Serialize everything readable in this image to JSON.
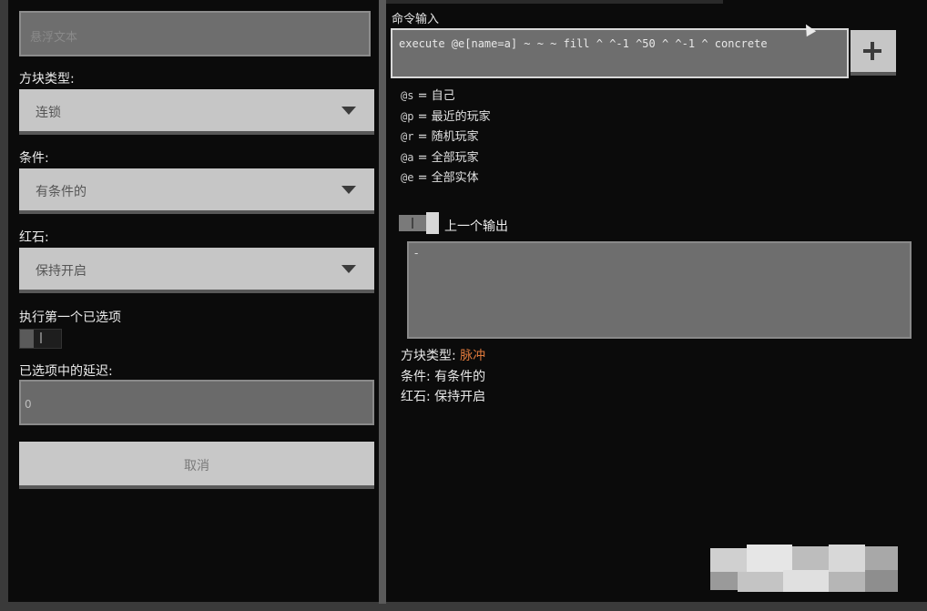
{
  "left_panel": {
    "hover_text_placeholder": "悬浮文本",
    "block_type_label": "方块类型:",
    "block_type_value": "连锁",
    "condition_label": "条件:",
    "condition_value": "有条件的",
    "redstone_label": "红石:",
    "redstone_value": "保持开启",
    "execute_first_label": "执行第一个已选项",
    "execute_first_enabled": false,
    "delay_label": "已选项中的延迟:",
    "delay_value": "0",
    "cancel_label": "取消"
  },
  "right_panel": {
    "command_input_label": "命令输入",
    "command_text": "execute @e[name=a] ~ ~ ~ fill ^ ^-1 ^50 ^ ^-1 ^ concrete",
    "add_button_icon": "plus-icon",
    "selectors": [
      {
        "code": "@s",
        "sep": " = ",
        "meaning": "自己"
      },
      {
        "code": "@p",
        "sep": " = ",
        "meaning": "最近的玩家"
      },
      {
        "code": "@r",
        "sep": " = ",
        "meaning": "随机玩家"
      },
      {
        "code": "@a",
        "sep": " = ",
        "meaning": "全部玩家"
      },
      {
        "code": "@e",
        "sep": " = ",
        "meaning": "全部实体"
      }
    ],
    "previous_output_label": "上一个输出",
    "previous_output_enabled": true,
    "previous_output_text": "-",
    "info": {
      "block_type_prefix": "方块类型: ",
      "block_type_value": "脉冲",
      "condition_line": "条件: 有条件的",
      "redstone_line": "红石: 保持开启"
    }
  },
  "colors": {
    "accent": "#e07a3c",
    "panel_bg": "#0b0b0b",
    "button_bg": "#c6c6c6",
    "field_bg": "#6e6e6e"
  }
}
